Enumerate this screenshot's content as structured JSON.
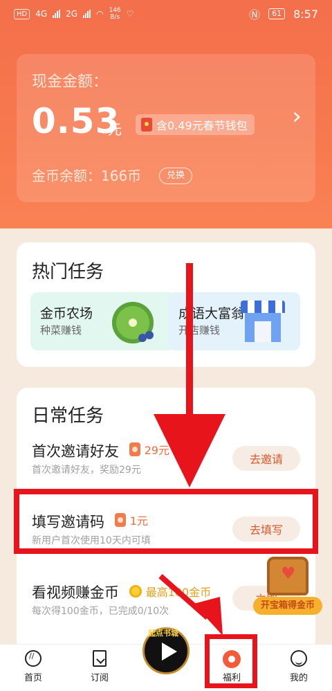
{
  "status_bar": {
    "hd_label": "HD",
    "net1_label": "4G",
    "net2_label": "2G",
    "speed_value": "146",
    "speed_unit": "B/s",
    "battery": "61",
    "time": "8:57"
  },
  "wallet": {
    "title": "现金金额：",
    "amount": "0.53",
    "unit": "元",
    "holiday_note": "含0.49元春节钱包",
    "coins_label": "金币余额：166币",
    "exchange_label": "兑换"
  },
  "hot_tasks": {
    "title": "热门任务",
    "items": [
      {
        "name": "金币农场",
        "subtitle": "种菜赚钱"
      },
      {
        "name": "成语大富翁",
        "subtitle": "开店赚钱"
      }
    ]
  },
  "daily_tasks": {
    "title": "日常任务",
    "items": [
      {
        "title": "首次邀请好友",
        "reward": "29元",
        "desc": "首次邀请好友，奖励29元",
        "button": "去邀请"
      },
      {
        "title": "填写邀请码",
        "reward": "1元",
        "desc": "新用户首次使用10天内可填",
        "button": "去填写"
      },
      {
        "title": "看视频赚金币",
        "reward": "最高100金币",
        "desc": "每次得100金币，已完成0/10次",
        "button": "立即"
      }
    ]
  },
  "treasure": {
    "label": "开宝箱得金币"
  },
  "play_stamp": "起点书城",
  "nav": {
    "items": [
      {
        "label": "首页",
        "icon": "home-icon"
      },
      {
        "label": "订阅",
        "icon": "bookmark-icon"
      },
      {
        "label": "福利",
        "icon": "welfare-icon"
      },
      {
        "label": "我的",
        "icon": "profile-icon"
      }
    ]
  },
  "colors": {
    "accent": "#f46f4b",
    "annotation_red": "#e8141c",
    "reward_orange": "#f26a3a",
    "gold": "#e2a11a"
  }
}
